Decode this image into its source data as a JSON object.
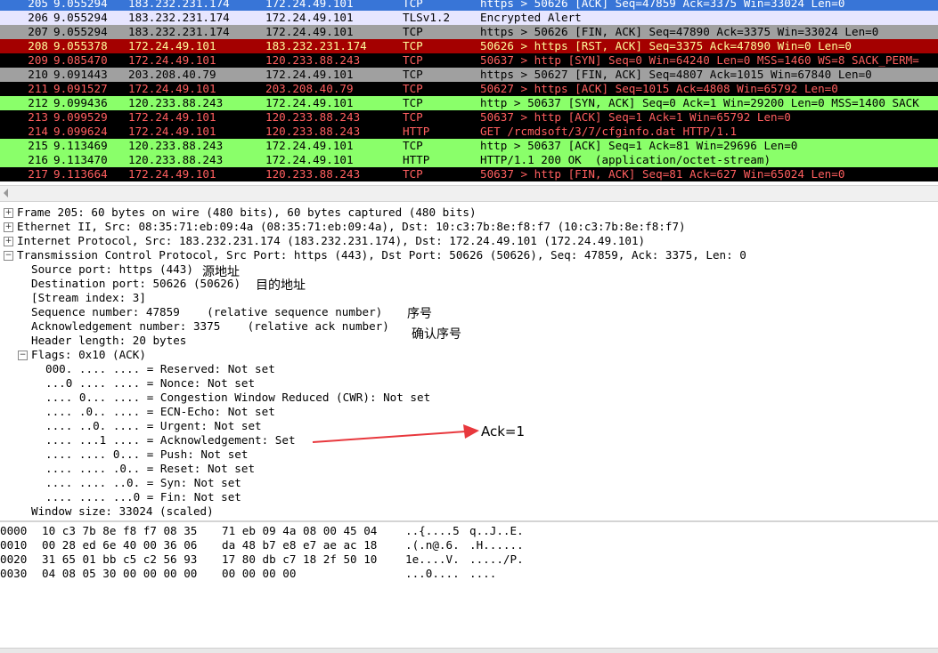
{
  "packets": [
    {
      "no": "205",
      "time": "9.055294",
      "src": "183.232.231.174",
      "dst": "172.24.49.101",
      "proto": "TCP",
      "info": "https > 50626 [ACK] Seq=47859 Ack=3375 Win=33024 Len=0",
      "bg": "#3875d7",
      "fg": "#ffffff"
    },
    {
      "no": "206",
      "time": "9.055294",
      "src": "183.232.231.174",
      "dst": "172.24.49.101",
      "proto": "TLSv1.2",
      "info": "Encrypted Alert",
      "bg": "#e7e6ff",
      "fg": "#000000"
    },
    {
      "no": "207",
      "time": "9.055294",
      "src": "183.232.231.174",
      "dst": "172.24.49.101",
      "proto": "TCP",
      "info": "https > 50626 [FIN, ACK] Seq=47890 Ack=3375 Win=33024 Len=0",
      "bg": "#a0a0a0",
      "fg": "#000000"
    },
    {
      "no": "208",
      "time": "9.055378",
      "src": "172.24.49.101",
      "dst": "183.232.231.174",
      "proto": "TCP",
      "info": "50626 > https [RST, ACK] Seq=3375 Ack=47890 Win=0 Len=0",
      "bg": "#a40000",
      "fg": "#fffc9c"
    },
    {
      "no": "209",
      "time": "9.085470",
      "src": "172.24.49.101",
      "dst": "120.233.88.243",
      "proto": "TCP",
      "info": "50637 > http [SYN] Seq=0 Win=64240 Len=0 MSS=1460 WS=8 SACK_PERM=",
      "bg": "#000000",
      "fg": "#ff5f5f"
    },
    {
      "no": "210",
      "time": "9.091443",
      "src": "203.208.40.79",
      "dst": "172.24.49.101",
      "proto": "TCP",
      "info": "https > 50627 [FIN, ACK] Seq=4807 Ack=1015 Win=67840 Len=0",
      "bg": "#a0a0a0",
      "fg": "#000000"
    },
    {
      "no": "211",
      "time": "9.091527",
      "src": "172.24.49.101",
      "dst": "203.208.40.79",
      "proto": "TCP",
      "info": "50627 > https [ACK] Seq=1015 Ack=4808 Win=65792 Len=0",
      "bg": "#000000",
      "fg": "#ff5f5f"
    },
    {
      "no": "212",
      "time": "9.099436",
      "src": "120.233.88.243",
      "dst": "172.24.49.101",
      "proto": "TCP",
      "info": "http > 50637 [SYN, ACK] Seq=0 Ack=1 Win=29200 Len=0 MSS=1400 SACK",
      "bg": "#8aff6a",
      "fg": "#000000"
    },
    {
      "no": "213",
      "time": "9.099529",
      "src": "172.24.49.101",
      "dst": "120.233.88.243",
      "proto": "TCP",
      "info": "50637 > http [ACK] Seq=1 Ack=1 Win=65792 Len=0",
      "bg": "#000000",
      "fg": "#ff5f5f"
    },
    {
      "no": "214",
      "time": "9.099624",
      "src": "172.24.49.101",
      "dst": "120.233.88.243",
      "proto": "HTTP",
      "info": "GET /rcmdsoft/3/7/cfginfo.dat HTTP/1.1",
      "bg": "#000000",
      "fg": "#ff5f5f"
    },
    {
      "no": "215",
      "time": "9.113469",
      "src": "120.233.88.243",
      "dst": "172.24.49.101",
      "proto": "TCP",
      "info": "http > 50637 [ACK] Seq=1 Ack=81 Win=29696 Len=0",
      "bg": "#8aff6a",
      "fg": "#000000"
    },
    {
      "no": "216",
      "time": "9.113470",
      "src": "120.233.88.243",
      "dst": "172.24.49.101",
      "proto": "HTTP",
      "info": "HTTP/1.1 200 OK  (application/octet-stream)",
      "bg": "#8aff6a",
      "fg": "#000000"
    },
    {
      "no": "217",
      "time": "9.113664",
      "src": "172.24.49.101",
      "dst": "120.233.88.243",
      "proto": "TCP",
      "info": "50637 > http [FIN, ACK] Seq=81 Ack=627 Win=65024 Len=0",
      "bg": "#000000",
      "fg": "#ff5f5f"
    }
  ],
  "details": {
    "frame": "Frame 205: 60 bytes on wire (480 bits), 60 bytes captured (480 bits)",
    "ethernet": "Ethernet II, Src: 08:35:71:eb:09:4a (08:35:71:eb:09:4a), Dst: 10:c3:7b:8e:f8:f7 (10:c3:7b:8e:f8:f7)",
    "ip": "Internet Protocol, Src: 183.232.231.174 (183.232.231.174), Dst: 172.24.49.101 (172.24.49.101)",
    "tcp": "Transmission Control Protocol, Src Port: https (443), Dst Port: 50626 (50626), Seq: 47859, Ack: 3375, Len: 0",
    "src_port": "Source port: https (443)",
    "dst_port": "Destination port: 50626 (50626)",
    "stream_index": "[Stream index: 3]",
    "seq": "Sequence number: 47859    (relative sequence number)",
    "ack": "Acknowledgement number: 3375    (relative ack number)",
    "header_len": "Header length: 20 bytes",
    "flags": "Flags: 0x10 (ACK)",
    "flag_lines": [
      "000. .... .... = Reserved: Not set",
      "...0 .... .... = Nonce: Not set",
      ".... 0... .... = Congestion Window Reduced (CWR): Not set",
      ".... .0.. .... = ECN-Echo: Not set",
      ".... ..0. .... = Urgent: Not set",
      ".... ...1 .... = Acknowledgement: Set",
      ".... .... 0... = Push: Not set",
      ".... .... .0.. = Reset: Not set",
      ".... .... ..0. = Syn: Not set",
      ".... .... ...0 = Fin: Not set"
    ],
    "window": "Window size: 33024 (scaled)"
  },
  "annotations": {
    "src": "源地址",
    "dst": "目的地址",
    "seq": "序号",
    "ack": "确认序号",
    "ack_flag": "Ack=1",
    "arrow_color": "#e8383d"
  },
  "hex": [
    {
      "off": "0000",
      "b1": "10 c3 7b 8e f8 f7 08 35",
      "b2": "71 eb 09 4a 08 00 45 04",
      "a1": "..{....5",
      "a2": "q..J..E."
    },
    {
      "off": "0010",
      "b1": "00 28 ed 6e 40 00 36 06",
      "b2": "da 48 b7 e8 e7 ae ac 18",
      "a1": ".(.n@.6.",
      "a2": ".H......"
    },
    {
      "off": "0020",
      "b1": "31 65 01 bb c5 c2 56 93",
      "b2": "17 80 db c7 18 2f 50 10",
      "a1": "1e....V.",
      "a2": "...../P."
    },
    {
      "off": "0030",
      "b1": "04 08 05 30 00 00 00 00",
      "b2": "00 00 00 00",
      "a1": "...0....",
      "a2": "...."
    }
  ]
}
